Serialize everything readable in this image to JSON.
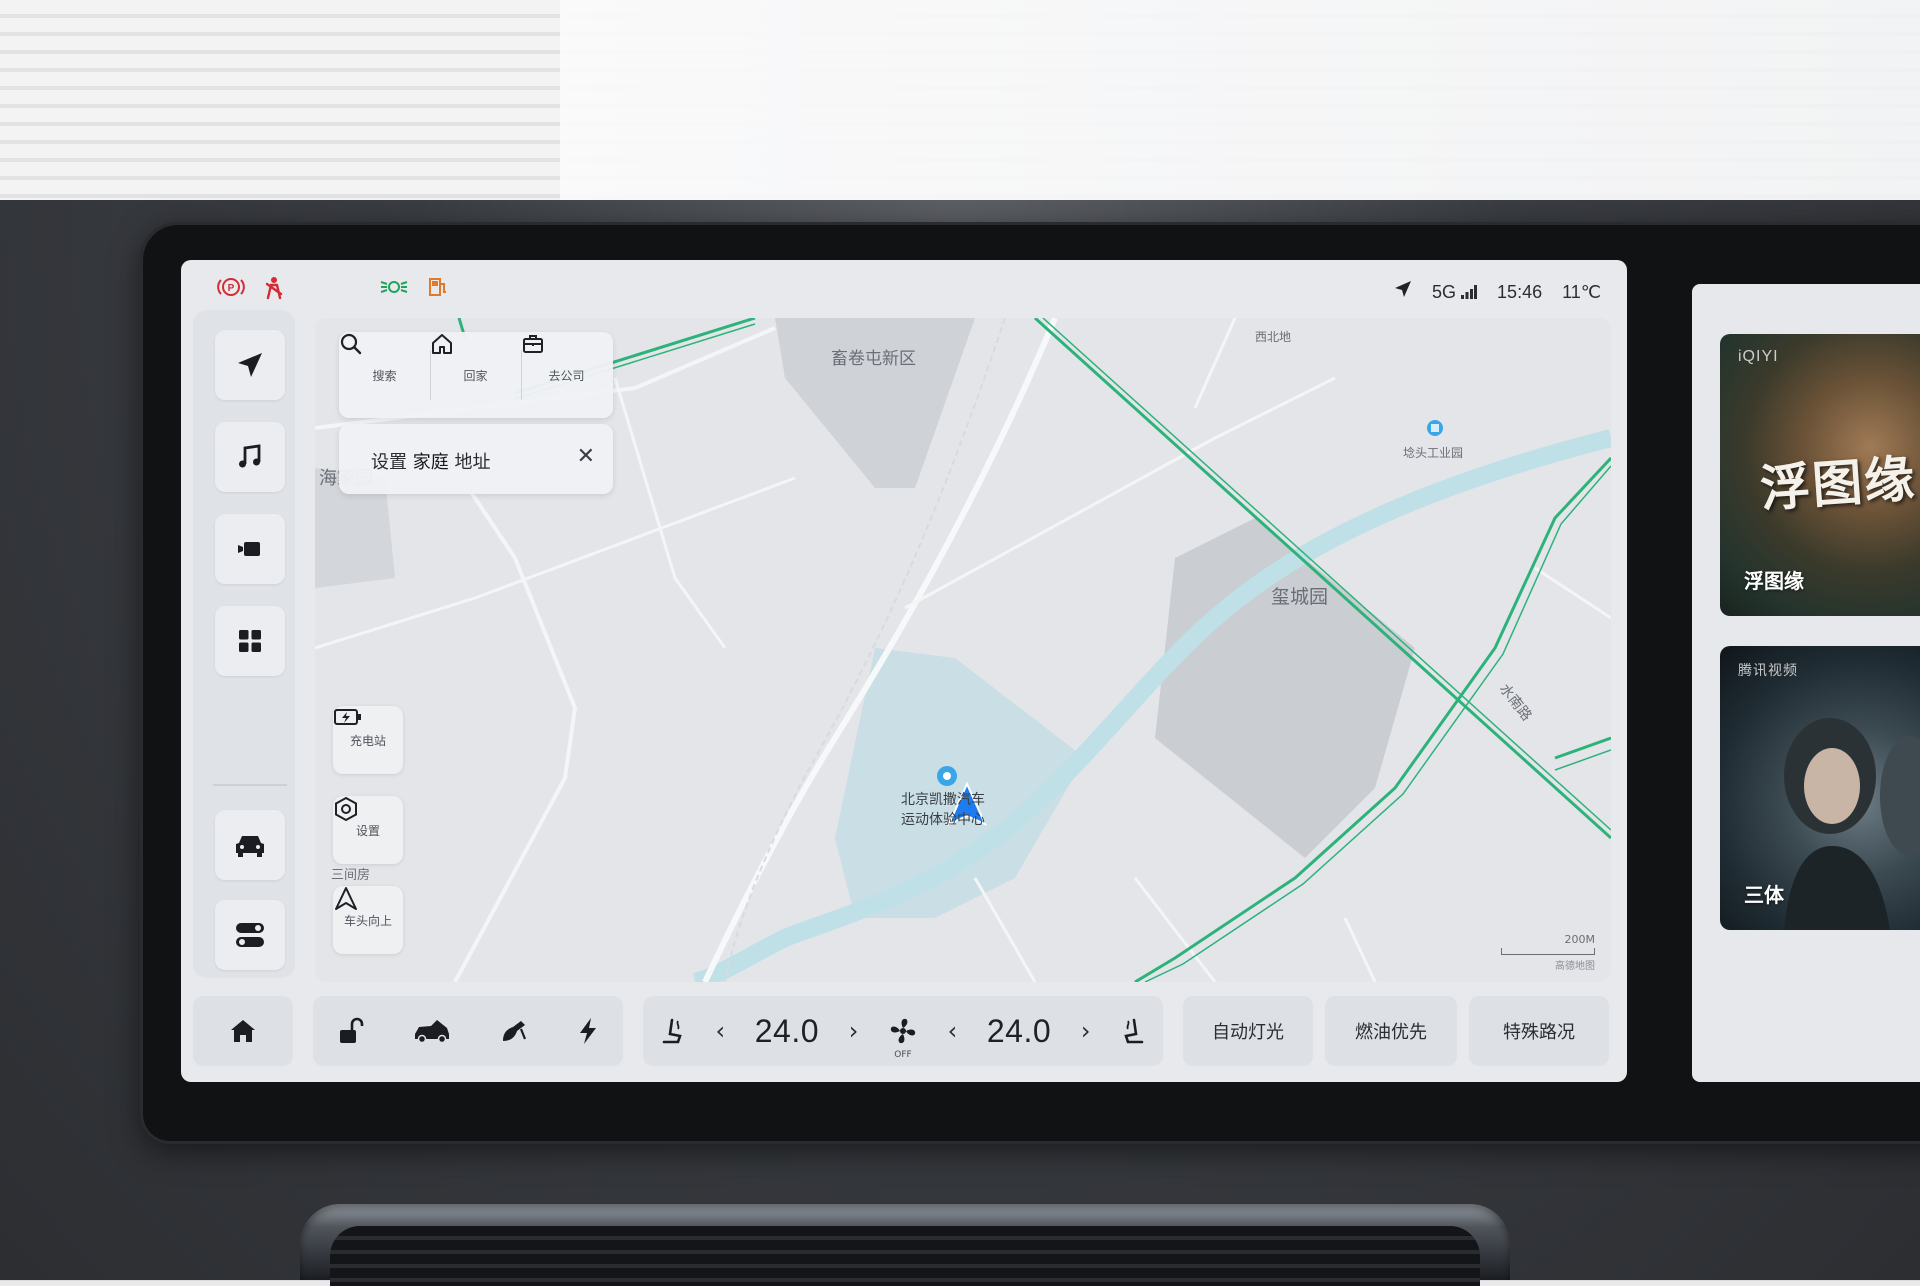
{
  "status": {
    "signal": "5G",
    "time": "15:46",
    "temperature": "11℃"
  },
  "quick_panel": {
    "search": "搜索",
    "home": "回家",
    "work": "去公司"
  },
  "home_prompt": {
    "prefix": "设置",
    "emphasis": "家庭",
    "suffix": "地址"
  },
  "map_tools": {
    "charging": "充电站",
    "settings": "设置",
    "heading_up": "车头向上"
  },
  "map_labels": {
    "area1": "畜卷屯新区",
    "area2": "海家园",
    "area3": "玺城园",
    "area4": "西北地",
    "industrial_park": "埝头工业园",
    "road": "水南路",
    "village": "三间房",
    "poi_line1": "北京凯撒汽车",
    "poi_line2": "运动体验中心"
  },
  "scale": {
    "distance": "200M",
    "provider": "高德地图"
  },
  "climate": {
    "driver_temp": "24.0",
    "passenger_temp": "24.0",
    "fan_status": "OFF"
  },
  "dock_buttons": {
    "auto_light": "自动灯光",
    "fuel_priority": "燃油优先",
    "special_road": "特殊路况"
  },
  "media": {
    "brand1": "iQIYI",
    "card1_art": "浮图缘",
    "card1_title": "浮图缘",
    "brand2": "腾讯视频",
    "card2_title": "三体"
  }
}
